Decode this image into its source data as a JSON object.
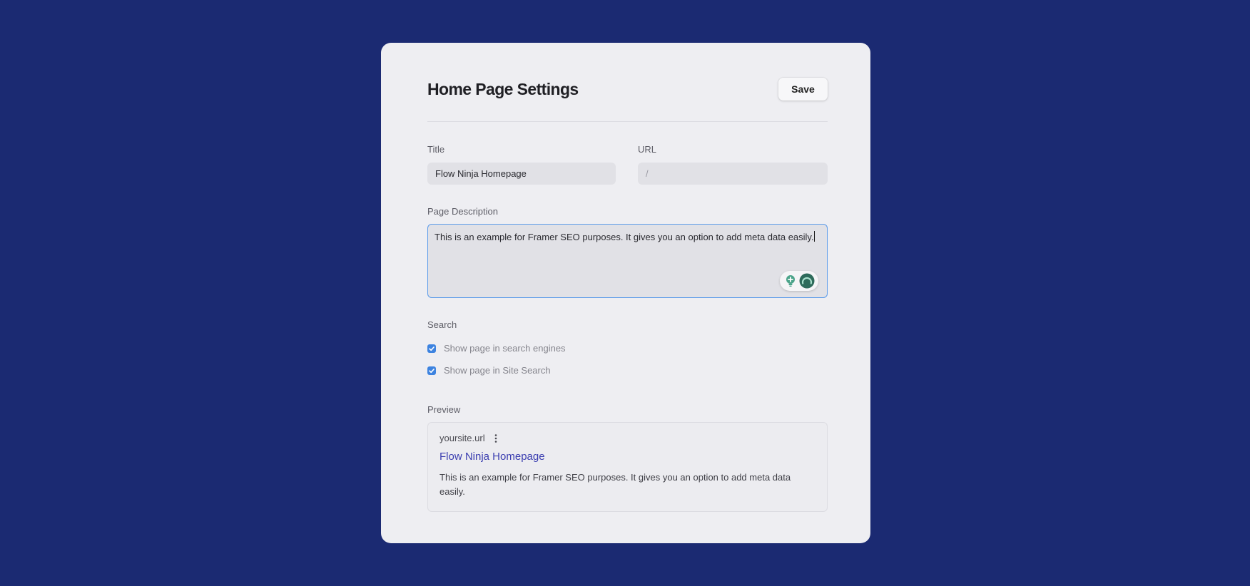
{
  "header": {
    "title": "Home Page Settings",
    "save_label": "Save"
  },
  "fields": {
    "title_label": "Title",
    "title_value": "Flow Ninja Homepage",
    "url_label": "URL",
    "url_placeholder": "/",
    "description_label": "Page Description",
    "description_value": "This is an example for Framer SEO purposes. It gives you an option to add meta data easily."
  },
  "search": {
    "label": "Search",
    "options": [
      {
        "label": "Show page in search engines",
        "checked": true
      },
      {
        "label": "Show page in Site Search",
        "checked": true
      }
    ]
  },
  "preview": {
    "label": "Preview",
    "site": "yoursite.url",
    "title": "Flow Ninja Homepage",
    "description": "This is an example for Framer SEO purposes. It gives you an option to add meta data easily."
  },
  "icons": {
    "assist_left": "lightbulb-icon",
    "assist_right": "spinner-icon",
    "site_menu": "kebab-icon"
  },
  "colors": {
    "background": "#1b2a72",
    "card": "#eeeef2",
    "accent": "#3d83e0",
    "focus_border": "#5b9bea",
    "link": "#3b3eb0"
  }
}
